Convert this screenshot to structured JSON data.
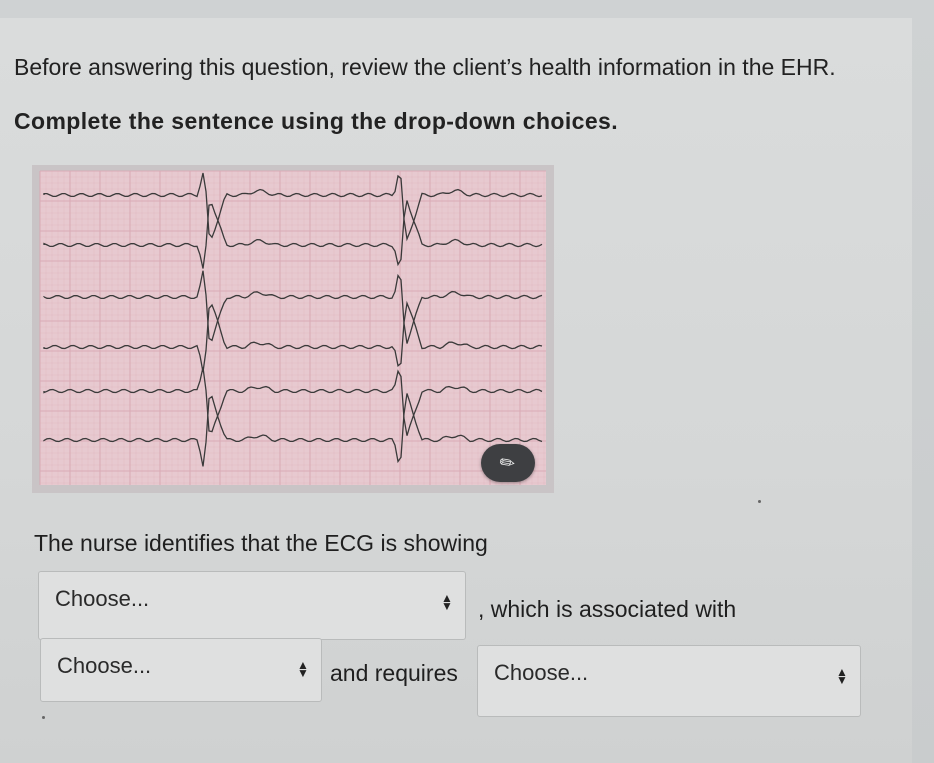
{
  "question": {
    "stem_normal": "Before answering this question, review the client’s health information in the EHR.",
    "stem_bold": "Complete the sentence using the drop-down choices."
  },
  "ecg_image": {
    "alt": "12-lead ECG strip",
    "edit_icon": "pencil-slash-icon"
  },
  "sentence": {
    "part1": "The nurse identifies that the ECG is showing",
    "part2": ", which is associated with",
    "part3": "and requires"
  },
  "dropdowns": [
    {
      "selected": "Choose..."
    },
    {
      "selected": "Choose..."
    },
    {
      "selected": "Choose..."
    }
  ],
  "colors": {
    "ecg_grid": "#d9a9b4",
    "ecg_trace": "#3a3a3a",
    "edit_button": "#3e3f42"
  }
}
